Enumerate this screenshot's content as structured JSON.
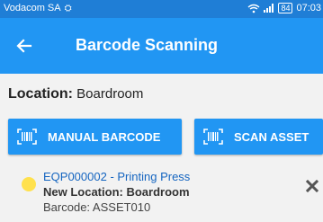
{
  "status_bar": {
    "carrier": "Vodacom SA",
    "battery": "84",
    "time": "07:03"
  },
  "app_bar": {
    "title": "Barcode Scanning",
    "back_icon": "arrow-back-icon"
  },
  "location": {
    "label": "Location:",
    "value": "Boardroom"
  },
  "buttons": {
    "manual": "MANUAL BARCODE",
    "scan": "SCAN ASSET",
    "icon": "barcode-scan-icon"
  },
  "asset": {
    "title": "EQP000002 - Printing Press",
    "new_location": "New Location: Boardroom",
    "barcode": "Barcode: ASSET010",
    "status_color": "#ffe14d",
    "remove_icon": "close-icon"
  },
  "colors": {
    "status_bar": "#1f7ed6",
    "app_bar": "#2196f3",
    "link": "#1565c0"
  }
}
